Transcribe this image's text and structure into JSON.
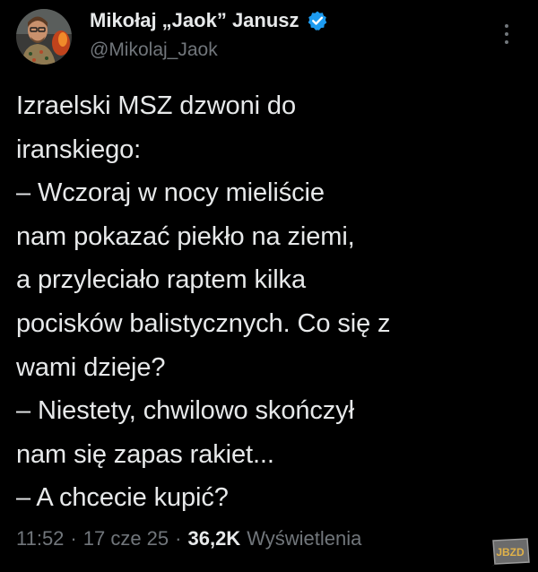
{
  "author": {
    "display_name": "Mikołaj „Jaok” Janusz",
    "handle": "@Mikolaj_Jaok",
    "verified": true,
    "verified_icon": "verified-badge-icon",
    "avatar_icon": "avatar-photo"
  },
  "tweet": {
    "text": "Izraelski MSZ dzwoni do\niranskiego:\n– Wczoraj w nocy mieliście\nnam pokazać piekło na ziemi,\na przyleciało raptem kilka\npocisków balistycznych. Co się z\nwami dzieje?\n– Niestety, chwilowo skończył\nnam się zapas rakiet...\n– A chcecie kupić?"
  },
  "meta": {
    "time": "11:52",
    "separator": "·",
    "date": "17 cze 25",
    "views_count": "36,2K",
    "views_label": "Wyświetlenia"
  },
  "watermark": {
    "text": "JBZD"
  },
  "colors": {
    "background": "#000000",
    "text_primary": "#e7e9ea",
    "text_secondary": "#71767b",
    "verified_blue": "#1d9bf0"
  }
}
